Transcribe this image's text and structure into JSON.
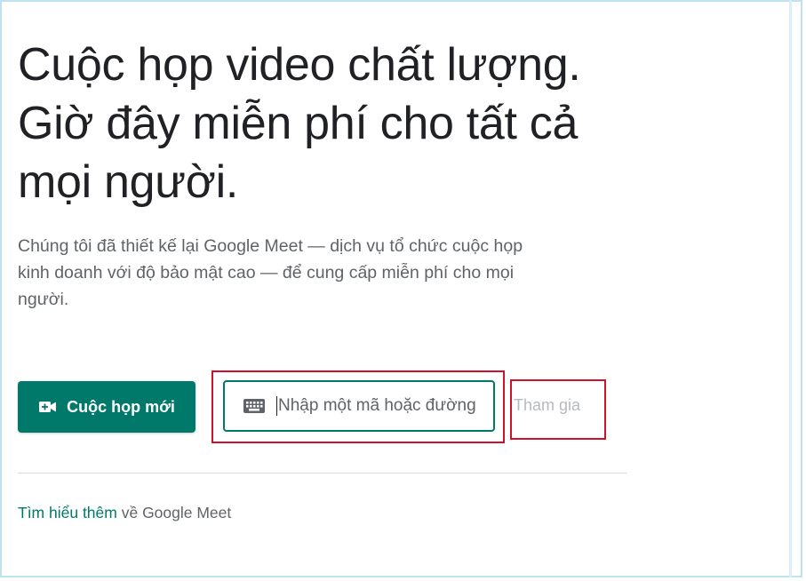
{
  "hero": {
    "headline": "Cuộc họp video chất lượng. Giờ đây miễn phí cho tất cả mọi người.",
    "description": "Chúng tôi đã thiết kế lại Google Meet — dịch vụ tổ chức cuộc họp kinh doanh với độ bảo mật cao — để cung cấp miễn phí cho mọi người."
  },
  "actions": {
    "new_meeting_label": "Cuộc họp mới",
    "new_meeting_icon": "video-plus-icon",
    "code_input_placeholder": "Nhập một mã hoặc đường",
    "code_input_icon": "keyboard-icon",
    "join_label": "Tham gia"
  },
  "footer": {
    "learn_more_link": "Tìm hiểu thêm",
    "learn_more_suffix": " về Google Meet"
  },
  "colors": {
    "brand_green": "#00796b",
    "highlight_red": "#d0112b",
    "text_dark": "#202124",
    "text_muted": "#5f6368",
    "disabled": "#b7babd"
  }
}
